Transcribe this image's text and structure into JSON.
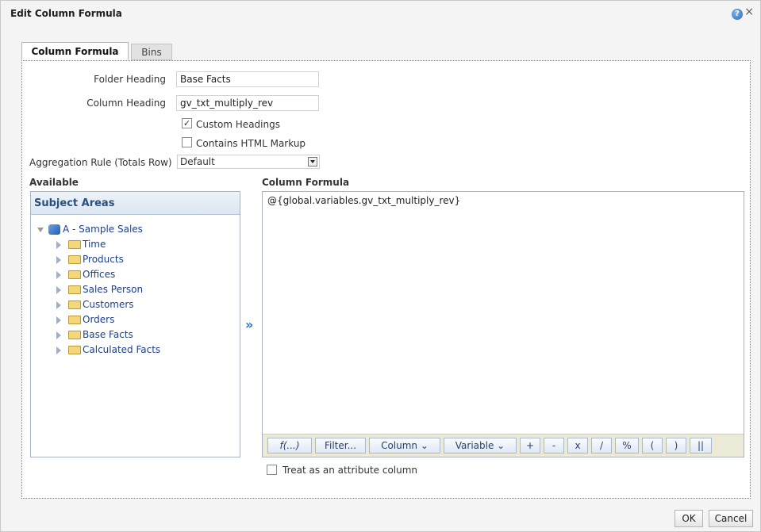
{
  "dialog": {
    "title": "Edit Column Formula",
    "help_icon": "?",
    "close_icon": "×"
  },
  "tabs": [
    {
      "label": "Column Formula"
    },
    {
      "label": "Bins"
    }
  ],
  "form": {
    "folder_heading_label": "Folder Heading",
    "folder_heading_value": "Base Facts",
    "column_heading_label": "Column Heading",
    "column_heading_value": "gv_txt_multiply_rev",
    "custom_headings_label": "Custom Headings",
    "custom_headings_checked": true,
    "contains_html_label": "Contains HTML Markup",
    "contains_html_checked": false,
    "aggregation_label": "Aggregation Rule (Totals Row)",
    "aggregation_value": "Default"
  },
  "available": {
    "label": "Available",
    "header": "Subject Areas",
    "root": "A - Sample Sales",
    "items": [
      "Time",
      "Products",
      "Offices",
      "Sales Person",
      "Customers",
      "Orders",
      "Base Facts",
      "Calculated Facts"
    ]
  },
  "formula": {
    "label": "Column Formula",
    "text": "@{global.variables.gv_txt_multiply_rev}",
    "toolbar": {
      "fx": "f(...)",
      "filter": "Filter...",
      "column": "Column",
      "variable": "Variable",
      "plus": "+",
      "minus": "-",
      "times": "x",
      "divide": "/",
      "percent": "%",
      "lparen": "(",
      "rparen": ")",
      "concat": "||"
    },
    "dropdown_icon": "⌄"
  },
  "attribute": {
    "label": "Treat as an attribute column",
    "checked": false
  },
  "buttons": {
    "ok": "OK",
    "cancel": "Cancel"
  },
  "colors": {
    "accent": "#2a6fc4",
    "toolbar_bg": "#ecebd9",
    "panel_border": "#a9b3bf"
  }
}
